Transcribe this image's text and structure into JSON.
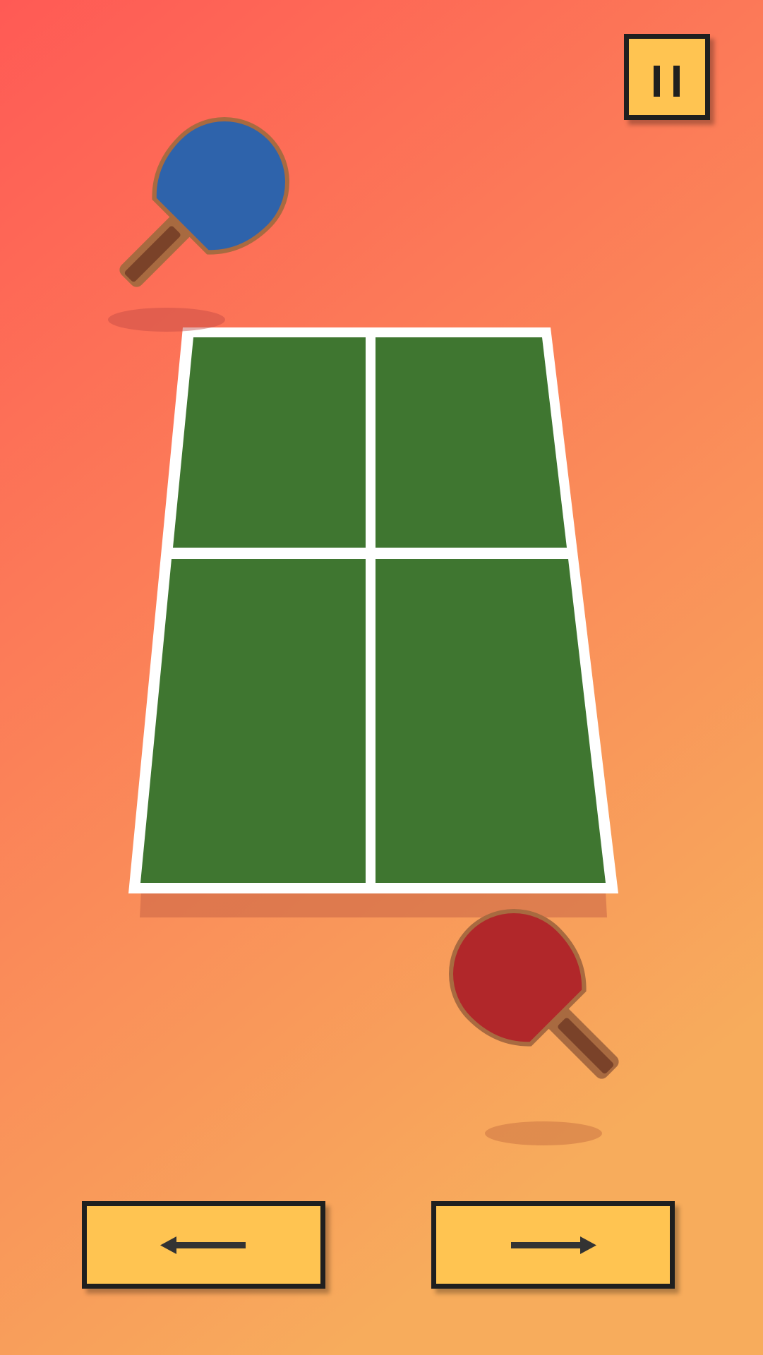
{
  "game": "table tennis",
  "colors": {
    "background_top": "#ff5a55",
    "background_bottom": "#f7ac5c",
    "table_surface": "#3f7630",
    "table_lines": "#ffffff",
    "table_shadow": "#c86446",
    "paddle_opponent": "#2e63ab",
    "paddle_player": "#b1272a",
    "paddle_handle": "#7a4229",
    "paddle_rim": "#a86a40",
    "button_fill": "#ffc451",
    "button_border": "#1f1f1f"
  },
  "controls": {
    "pause": {
      "icon": "pause-icon"
    },
    "left": {
      "icon": "arrow-left-icon"
    },
    "right": {
      "icon": "arrow-right-icon"
    }
  },
  "opponent_paddle": {
    "icon": "paddle-icon",
    "color": "blue"
  },
  "player_paddle": {
    "icon": "paddle-icon",
    "color": "red"
  }
}
